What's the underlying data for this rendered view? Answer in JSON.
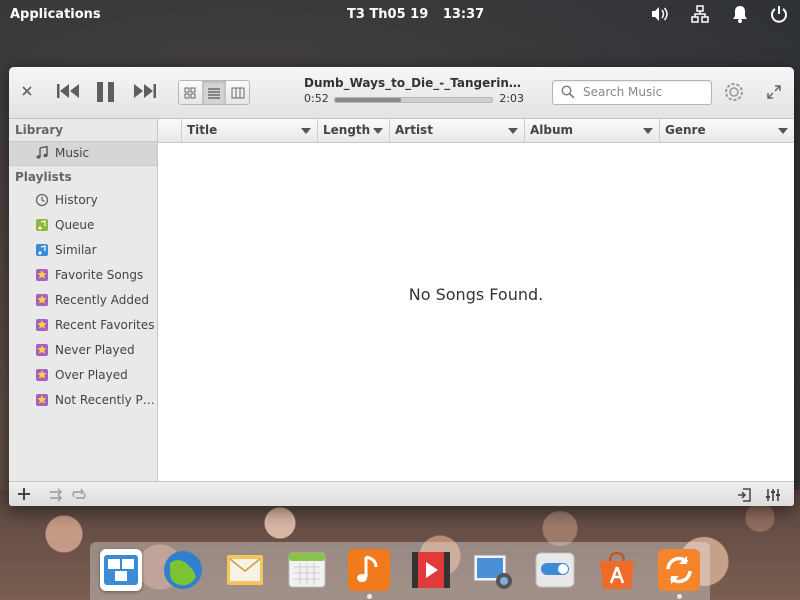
{
  "panel": {
    "applications_label": "Applications",
    "date": "T3 Th05 19",
    "time": "13:37",
    "indicators": [
      "volume-icon",
      "network-icon",
      "notifications-icon",
      "power-icon"
    ]
  },
  "player": {
    "now_playing": {
      "title": "Dumb_Ways_to_Die_-_Tangerine_Kit...",
      "elapsed": "0:52",
      "total": "2:03",
      "progress": 0.42
    },
    "search": {
      "placeholder": "Search Music"
    }
  },
  "sidebar": {
    "library_header": "Library",
    "library_items": [
      {
        "label": "Music",
        "icon": "music-note-icon"
      }
    ],
    "playlists_header": "Playlists",
    "playlists": [
      {
        "label": "History",
        "icon": "history-icon"
      },
      {
        "label": "Queue",
        "icon": "queue-icon"
      },
      {
        "label": "Similar",
        "icon": "similar-icon"
      },
      {
        "label": "Favorite Songs",
        "icon": "smart-playlist-icon"
      },
      {
        "label": "Recently Added",
        "icon": "smart-playlist-icon"
      },
      {
        "label": "Recent Favorites",
        "icon": "smart-playlist-icon"
      },
      {
        "label": "Never Played",
        "icon": "smart-playlist-icon"
      },
      {
        "label": "Over Played",
        "icon": "smart-playlist-icon"
      },
      {
        "label": "Not Recently Pla...",
        "icon": "smart-playlist-icon"
      }
    ]
  },
  "list": {
    "columns": [
      "Title",
      "Length",
      "Artist",
      "Album",
      "Genre"
    ],
    "empty_message": "No Songs Found."
  },
  "dock": {
    "apps": [
      "multitasking-view",
      "web-browser",
      "mail",
      "calendar",
      "music",
      "videos",
      "photos",
      "system-settings",
      "app-center",
      "software-updates"
    ],
    "colors": {
      "music": "#f07a1c",
      "app_center": "#ef6b2a",
      "updates": "#f5842a"
    }
  }
}
